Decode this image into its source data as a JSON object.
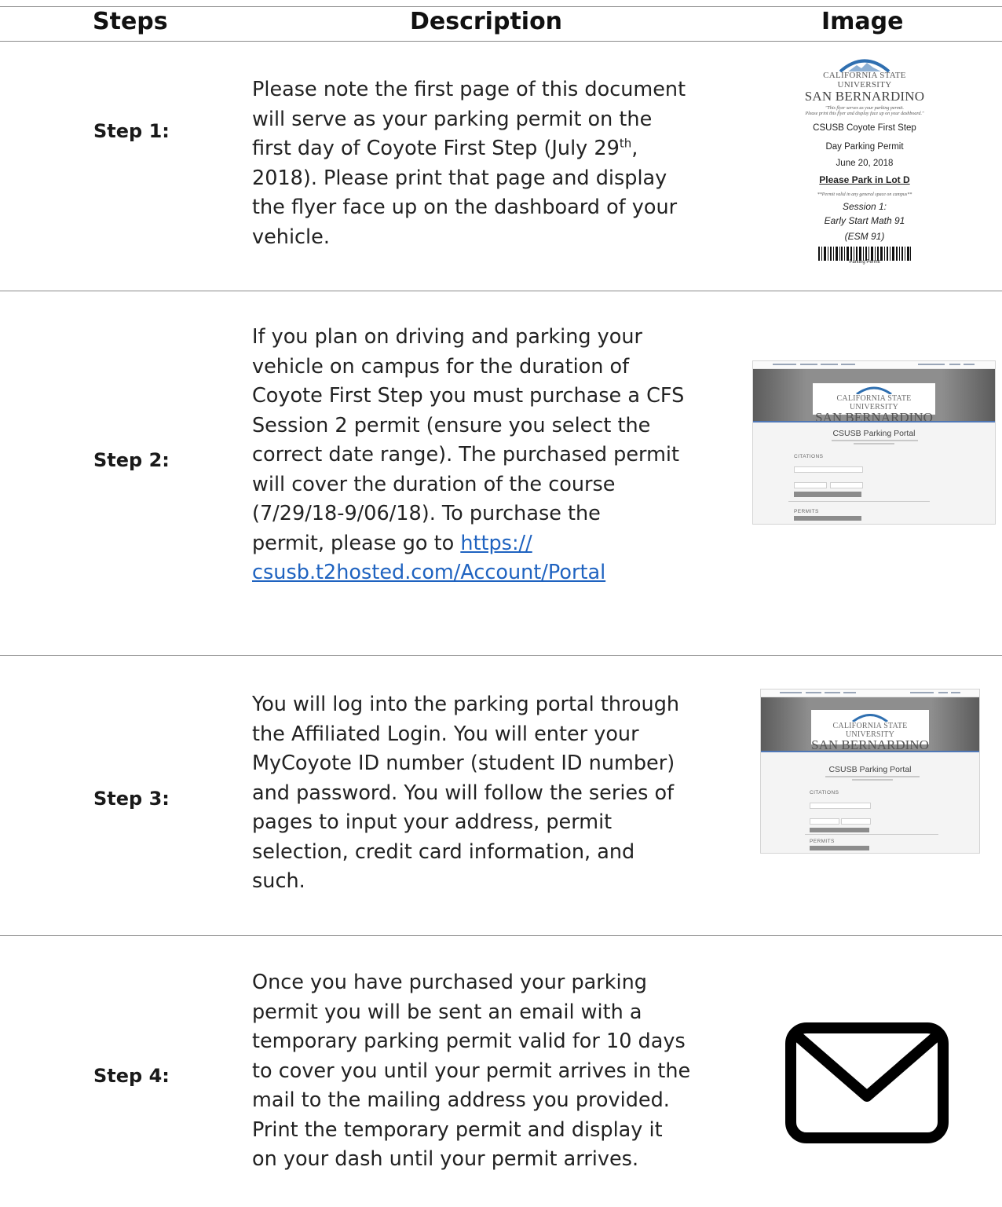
{
  "headers": {
    "steps": "Steps",
    "description": "Description",
    "image": "Image"
  },
  "rows": [
    {
      "label": "Step 1:",
      "lines": [
        "Please note the first page of this document",
        "will serve as your parking permit on the"
      ],
      "line3_pre": "first day of Coyote First Step (July 29",
      "line3_sup": "th",
      "line3_post": ",",
      "lines_after": [
        "2018).  Please print that page and display",
        "the flyer face up on the dashboard of your",
        "vehicle."
      ]
    },
    {
      "label": "Step 2:",
      "lines": [
        "If you plan on driving and parking your",
        "vehicle on campus for the duration of",
        "Coyote First Step you must purchase a CFS",
        "Session 2 permit (ensure you select the",
        "correct date range). The purchased permit",
        "will cover the duration of the course",
        "(7/29/18-9/06/18).  To purchase the"
      ],
      "link_pre": "permit, please go to ",
      "link_part1": "https://",
      "link_part2": "csusb.t2hosted.com/Account/Portal"
    },
    {
      "label": "Step 3:",
      "lines": [
        "You will log into the parking portal through",
        "the Affiliated Login. You will enter your",
        "MyCoyote ID number (student ID number)",
        "and password. You will follow the series of",
        "pages to input your address, permit",
        "selection, credit card information, and",
        "such."
      ]
    },
    {
      "label": "Step 4:",
      "lines": [
        "Once you have purchased your parking",
        "permit you will be sent an email with a",
        "temporary parking permit valid for 10 days",
        "to cover you until your permit arrives in the",
        "mail to the mailing address you provided.",
        "Print the temporary permit and display it",
        "on your dash until your permit arrives."
      ]
    }
  ],
  "flyer": {
    "university_line1": "CALIFORNIA STATE UNIVERSITY",
    "university_line2": "SAN BERNARDINO",
    "note1": "\"This flyer serves as your parking permit.",
    "note2": "Please print this flyer and display face up on your dashboard.\"",
    "title1": "CSUSB Coyote First Step",
    "title2": "Day Parking Permit",
    "date": "June 20, 2018",
    "lot": "Please Park in Lot D",
    "valid_note": "**Permit valid in any general space on campus**",
    "session": "Session 1:",
    "course": "Early Start Math 91",
    "code": "(ESM 91)",
    "barcode_label": "Parking Permit"
  },
  "portal": {
    "university_line1": "CALIFORNIA STATE UNIVERSITY",
    "university_line2": "SAN BERNARDINO",
    "title": "CSUSB Parking Portal",
    "citations": "CITATIONS",
    "permits": "PERMITS"
  },
  "colors": {
    "link": "#1f63c0",
    "accent_blue": "#4f77b6",
    "rule": "#8a8a8a"
  },
  "icons": {
    "step4_image": "envelope-icon",
    "flyer_logo": "arc-logo-icon"
  }
}
